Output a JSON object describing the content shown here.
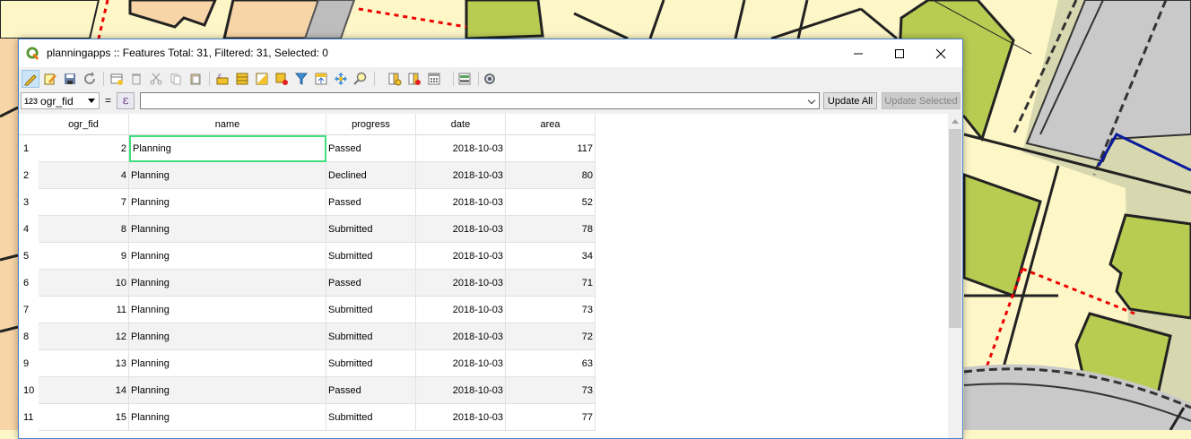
{
  "window": {
    "title": "planningapps :: Features Total: 31, Filtered: 31, Selected: 0",
    "minimize_icon": "minimize-icon",
    "maximize_icon": "maximize-icon",
    "close_icon": "close-icon"
  },
  "toolbar": {
    "icons": [
      "toggle-editing-icon",
      "multi-edit-icon",
      "save-edits-icon",
      "reload-icon",
      "add-feature-icon",
      "delete-feature-icon",
      "cut-icon",
      "copy-icon",
      "paste-icon",
      "select-by-expression-icon",
      "select-all-icon",
      "invert-selection-icon",
      "deselect-all-icon",
      "filter-icon",
      "move-selection-to-top-icon",
      "pan-to-selected-icon",
      "zoom-to-selected-icon",
      "new-field-icon",
      "delete-field-icon",
      "open-field-calculator-icon",
      "conditional-formatting-icon",
      "actions-icon"
    ]
  },
  "expression_bar": {
    "field_type_label": "123",
    "field_name": "ogr_fid",
    "equals": "=",
    "expression_button": "ε",
    "expression_value": "",
    "update_all_label": "Update All",
    "update_selected_label": "Update Selected"
  },
  "table": {
    "columns": [
      "ogr_fid",
      "name",
      "progress",
      "date",
      "area"
    ],
    "rows": [
      {
        "n": "1",
        "ogr_fid": "2",
        "name": "Planning",
        "progress": "Passed",
        "date": "2018-10-03",
        "area": "117"
      },
      {
        "n": "2",
        "ogr_fid": "4",
        "name": "Planning",
        "progress": "Declined",
        "date": "2018-10-03",
        "area": "80"
      },
      {
        "n": "3",
        "ogr_fid": "7",
        "name": "Planning",
        "progress": "Passed",
        "date": "2018-10-03",
        "area": "52"
      },
      {
        "n": "4",
        "ogr_fid": "8",
        "name": "Planning",
        "progress": "Submitted",
        "date": "2018-10-03",
        "area": "78"
      },
      {
        "n": "5",
        "ogr_fid": "9",
        "name": "Planning",
        "progress": "Submitted",
        "date": "2018-10-03",
        "area": "34"
      },
      {
        "n": "6",
        "ogr_fid": "10",
        "name": "Planning",
        "progress": "Passed",
        "date": "2018-10-03",
        "area": "71"
      },
      {
        "n": "7",
        "ogr_fid": "11",
        "name": "Planning",
        "progress": "Submitted",
        "date": "2018-10-03",
        "area": "73"
      },
      {
        "n": "8",
        "ogr_fid": "12",
        "name": "Planning",
        "progress": "Submitted",
        "date": "2018-10-03",
        "area": "72"
      },
      {
        "n": "9",
        "ogr_fid": "13",
        "name": "Planning",
        "progress": "Submitted",
        "date": "2018-10-03",
        "area": "63"
      },
      {
        "n": "10",
        "ogr_fid": "14",
        "name": "Planning",
        "progress": "Passed",
        "date": "2018-10-03",
        "area": "73"
      },
      {
        "n": "11",
        "ogr_fid": "15",
        "name": "Planning",
        "progress": "Submitted",
        "date": "2018-10-03",
        "area": "77"
      }
    ]
  },
  "colors": {
    "map_background": "#fdf7c8",
    "building_green": "#b8cc52",
    "selection_border": "#3ee07e",
    "qgis_green": "#589632"
  }
}
